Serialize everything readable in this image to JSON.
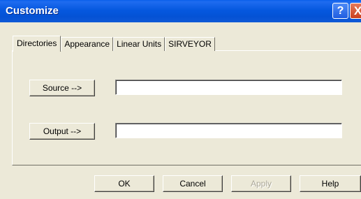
{
  "window": {
    "title": "Customize",
    "help_glyph": "?",
    "close_glyph": "X"
  },
  "tabs": [
    {
      "label": "Directories",
      "active": true
    },
    {
      "label": "Appearance",
      "active": false
    },
    {
      "label": "Linear Units",
      "active": false
    },
    {
      "label": "SIRVEYOR",
      "active": false
    }
  ],
  "directories": {
    "source_button": "Source -->",
    "source_value": "",
    "output_button": "Output -->",
    "output_value": ""
  },
  "footer": {
    "ok": "OK",
    "cancel": "Cancel",
    "apply": "Apply",
    "help": "Help"
  },
  "colors": {
    "titlebar": "#0558DF",
    "face": "#ECE9D8",
    "disabled_text": "#ACA899"
  }
}
